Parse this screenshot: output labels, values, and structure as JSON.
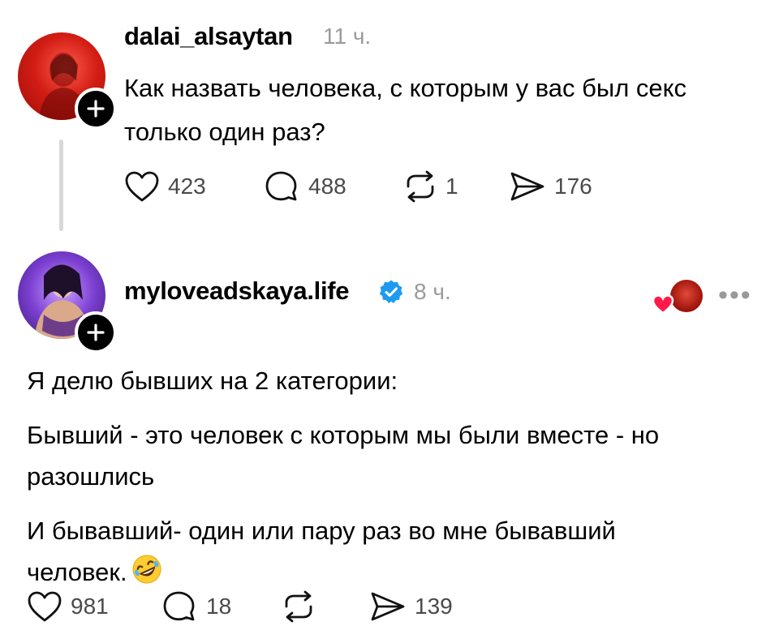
{
  "post1": {
    "username": "dalai_alsaytan",
    "time": "11 ч.",
    "text_line1": "Как назвать человека, с которым у вас был секс",
    "text_line2": "только один раз?",
    "likes": "423",
    "comments": "488",
    "reposts": "1",
    "shares": "176"
  },
  "post2": {
    "username": "myloveadskaya.life",
    "time": "8 ч.",
    "p1": "Я делю бывших на 2 категории:",
    "p2a": "Бывший - это человек с которым мы были вместе - но",
    "p2b": "разошлись",
    "p3a": "И бывавший- один или пару раз во мне бывавший",
    "p3b": "человек.",
    "likes": "981",
    "comments": "18",
    "shares": "139"
  },
  "icons": {
    "like": "heart-icon",
    "comment": "comment-bubble-icon",
    "repost": "repost-icon",
    "share": "send-icon",
    "verified": "verified-badge-icon",
    "follow": "plus-icon",
    "more": "more-options-icon",
    "emoji": "rolling-laughing-emoji"
  },
  "colors": {
    "verified": "#1d9bf0",
    "liked_heart": "#ff1a4b",
    "muted_text": "#9a9a9a"
  }
}
